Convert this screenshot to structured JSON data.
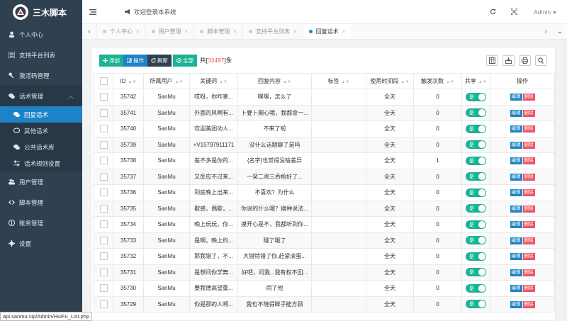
{
  "brand": {
    "name": "三木脚本"
  },
  "sidebar": {
    "items": [
      {
        "label": "个人中心",
        "icon": "user-icon"
      },
      {
        "label": "支持平台列表",
        "icon": "list-icon"
      },
      {
        "label": "激活码管理",
        "icon": "key-icon"
      },
      {
        "label": "话术管理",
        "icon": "comments-icon"
      },
      {
        "label": "用户管理",
        "icon": "users-icon"
      },
      {
        "label": "脚本管理",
        "icon": "code-icon"
      },
      {
        "label": "账务管理",
        "icon": "money-icon"
      },
      {
        "label": "设置",
        "icon": "gear-icon"
      }
    ],
    "submenu": [
      {
        "label": "回复话术",
        "icon": "comments-icon"
      },
      {
        "label": "其他话术",
        "icon": "comment-icon"
      },
      {
        "label": "公共话术库",
        "icon": "comments-icon"
      },
      {
        "label": "话术规则设置",
        "icon": "sliders-icon"
      }
    ]
  },
  "topbar": {
    "welcome": "欢迎登录本系统",
    "user": "Admin"
  },
  "tabs": [
    {
      "label": "个人中心"
    },
    {
      "label": "用户管理"
    },
    {
      "label": "脚本管理"
    },
    {
      "label": "支持平台列表"
    },
    {
      "label": "回复话术"
    }
  ],
  "toolbar": {
    "add": "添加",
    "op": "操作",
    "refresh": "刷新",
    "all": "全部",
    "count_prefix": "共[",
    "count": "33497",
    "count_suffix": "]条"
  },
  "table": {
    "headers": [
      "ID",
      "所属用户",
      "关键词",
      "回复内容",
      "标签",
      "使用时间段",
      "触发次数",
      "共享",
      "操作"
    ],
    "toggle_label": "是",
    "edit_label": "编辑",
    "delete_label": "删除",
    "rows": [
      [
        "35742",
        "SanMu",
        "哎呀，你咋害...",
        "嘿嘿，怎么了",
        "",
        "全天",
        "0"
      ],
      [
        "35741",
        "SanMu",
        "外面的风啊有...",
        "卜要卜開心哦，我都會一...",
        "",
        "全天",
        "0"
      ],
      [
        "35740",
        "SanMu",
        "欢迎美团动人...",
        "不来了啦",
        "",
        "全天",
        "0"
      ],
      [
        "35739",
        "SanMu",
        "+V15797911171",
        "没什么话题聊了是吗",
        "",
        "全天",
        "0"
      ],
      [
        "35738",
        "SanMu",
        "差不多是你的...",
        "{名字}也觉得没啥差异",
        "",
        "全天",
        "1"
      ],
      [
        "35737",
        "SanMu",
        "又反应不过来...",
        "一癸二闹三吞枪好了...",
        "",
        "全天",
        "0"
      ],
      [
        "35736",
        "SanMu",
        "到底晚上出来...",
        "不喜欢？为什么",
        "",
        "全天",
        "0"
      ],
      [
        "35735",
        "SanMu",
        "歇感，偶歇，...",
        "你说的什么哦？换种说法...",
        "",
        "全天",
        "0"
      ],
      [
        "35734",
        "SanMu",
        "晚上玩玩，你...",
        "摸开心是不，我都听到你...",
        "",
        "全天",
        "0"
      ],
      [
        "35733",
        "SanMu",
        "是啊，晚上约...",
        "哦了哦了",
        "",
        "全天",
        "0"
      ],
      [
        "35732",
        "SanMu",
        "那我错了，不...",
        "大错特错了你,赶紧滚蛋...",
        "",
        "全天",
        "0"
      ],
      [
        "35731",
        "SanMu",
        "是想问你学舞...",
        "好吧，问我...我有权不回...",
        "",
        "全天",
        "0"
      ],
      [
        "35730",
        "SanMu",
        "要我德高望重...",
        "闹了他",
        "",
        "全天",
        "0"
      ],
      [
        "35729",
        "SanMu",
        "你是那的人啊...",
        "我也不晓得眯子能方顾",
        "",
        "全天",
        "0"
      ]
    ]
  },
  "status_url": "api.sanmu.vip/Admin/HuiFu_List.php"
}
